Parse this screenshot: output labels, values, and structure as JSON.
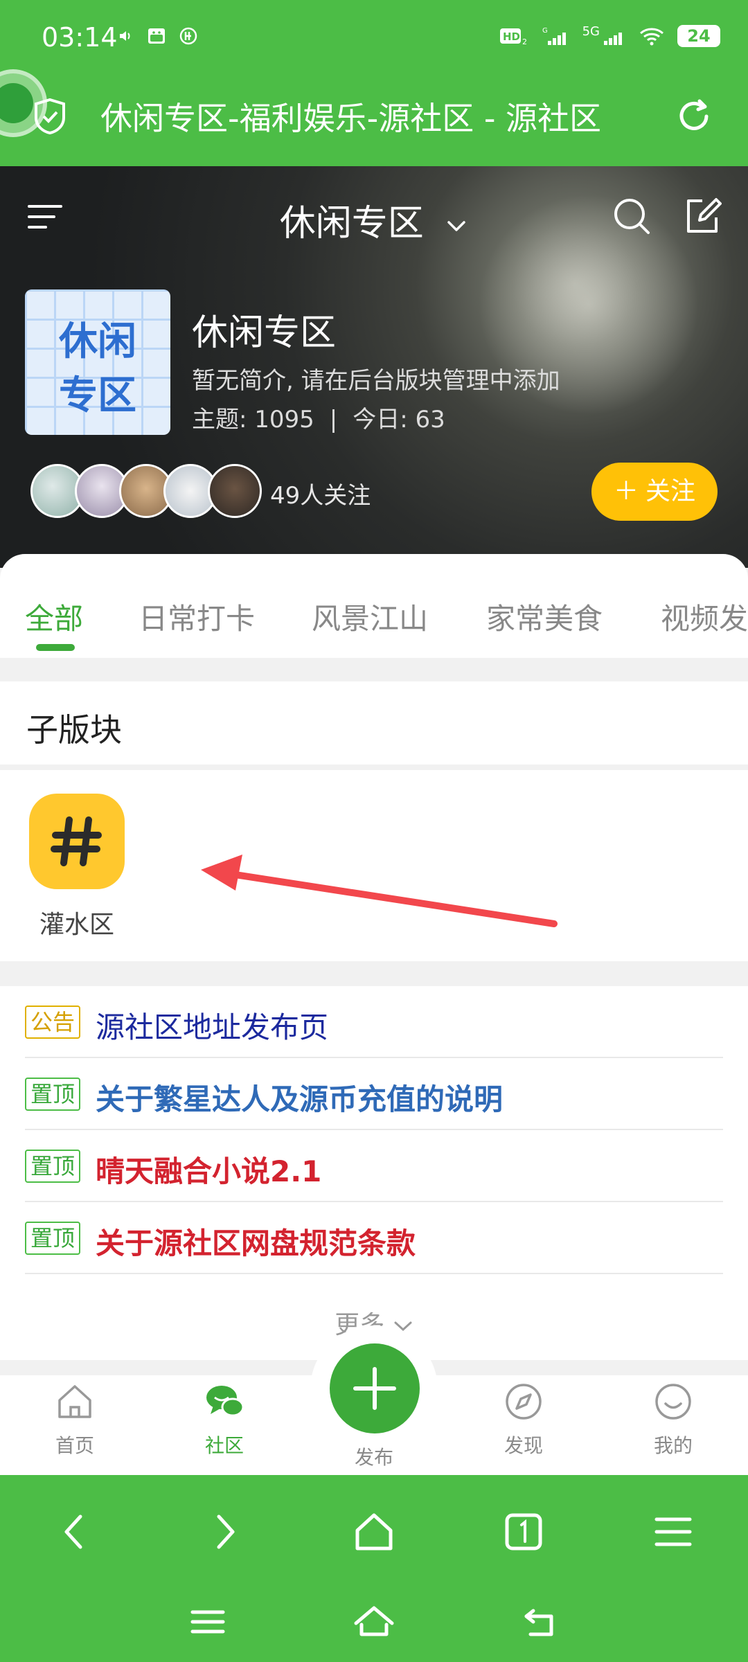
{
  "status_bar": {
    "time": "03:14",
    "network": "5G",
    "battery": "24"
  },
  "browser": {
    "title": "休闲专区-福利娱乐-源社区 - 源社区"
  },
  "forum": {
    "switcher_label": "休闲专区",
    "thumb_line1": "休闲",
    "thumb_line2": "专区",
    "name": "休闲专区",
    "description": "暂无简介, 请在后台版块管理中添加",
    "topics_label": "主题: 1095",
    "separator": "|",
    "today_label": "今日: 63",
    "followers": "49人关注",
    "follow_button": "关注",
    "follow_plus": "＋"
  },
  "tabs": [
    {
      "label": "全部",
      "active": true
    },
    {
      "label": "日常打卡",
      "active": false
    },
    {
      "label": "风景江山",
      "active": false
    },
    {
      "label": "家常美食",
      "active": false
    },
    {
      "label": "视频发",
      "active": false
    }
  ],
  "subforums": {
    "header": "子版块",
    "items": [
      {
        "label": "灌水区",
        "icon": "hash-icon",
        "icon_color": "#ffc82e"
      }
    ]
  },
  "notices": [
    {
      "tag": "公告",
      "title": "源社区地址发布页",
      "tag_color": "#d5a000",
      "title_color": "#1c2a9e"
    },
    {
      "tag": "置顶",
      "title": "关于繁星达人及源币充值的说明",
      "tag_color": "#38a83a",
      "title_color": "#2f6ab7"
    },
    {
      "tag": "置顶",
      "title": "晴天融合小说2.1",
      "tag_color": "#38a83a",
      "title_color": "#d3232f"
    },
    {
      "tag": "置顶",
      "title": "关于源社区网盘规范条款",
      "tag_color": "#38a83a",
      "title_color": "#d3232f"
    }
  ],
  "more_label": "更多",
  "app_nav": {
    "home": "首页",
    "community": "社区",
    "publish": "发布",
    "discover": "发现",
    "mine": "我的",
    "active": "community"
  },
  "colors": {
    "brand_green": "#4cbd46",
    "accent_green": "#3daa3a",
    "follow_yellow": "#ffc107"
  }
}
